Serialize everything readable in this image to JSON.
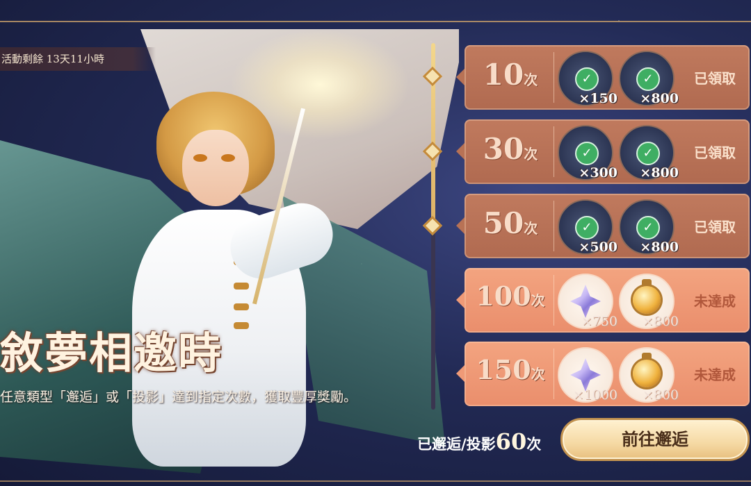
{
  "event": {
    "timer_text": "活動剩餘 13天11小時",
    "title": "敘夢相邀時",
    "description": "任意類型「邂逅」或「投影」達到指定次數，獲取豐厚獎勵。"
  },
  "rewards": [
    {
      "count": "10",
      "unit": "次",
      "status": "已領取",
      "claimed": true,
      "items": [
        {
          "icon": "star-crystal-icon",
          "qty": "×150"
        },
        {
          "icon": "star-orb-icon",
          "qty": "×800"
        }
      ]
    },
    {
      "count": "30",
      "unit": "次",
      "status": "已領取",
      "claimed": true,
      "items": [
        {
          "icon": "star-crystal-icon",
          "qty": "×300"
        },
        {
          "icon": "star-orb-icon",
          "qty": "×800"
        }
      ]
    },
    {
      "count": "50",
      "unit": "次",
      "status": "已領取",
      "claimed": true,
      "items": [
        {
          "icon": "star-crystal-icon",
          "qty": "×500"
        },
        {
          "icon": "star-orb-icon",
          "qty": "×800"
        }
      ]
    },
    {
      "count": "100",
      "unit": "次",
      "status": "未達成",
      "claimed": false,
      "items": [
        {
          "icon": "star-crystal-icon",
          "qty": "×750"
        },
        {
          "icon": "star-orb-icon",
          "qty": "×800"
        }
      ]
    },
    {
      "count": "150",
      "unit": "次",
      "status": "未達成",
      "claimed": false,
      "items": [
        {
          "icon": "star-crystal-icon",
          "qty": "×1000"
        },
        {
          "icon": "star-orb-icon",
          "qty": "×800"
        }
      ]
    }
  ],
  "footer": {
    "progress_label": "已邂逅/投影",
    "progress_value": "60",
    "progress_unit": "次",
    "go_button": "前往邂逅"
  },
  "icons": {
    "claimed_check": "check-icon"
  },
  "colors": {
    "claimed_row": "#b87255",
    "pending_row": "#ef9a77",
    "check": "#3fae63",
    "gold": "#c98c3e"
  }
}
